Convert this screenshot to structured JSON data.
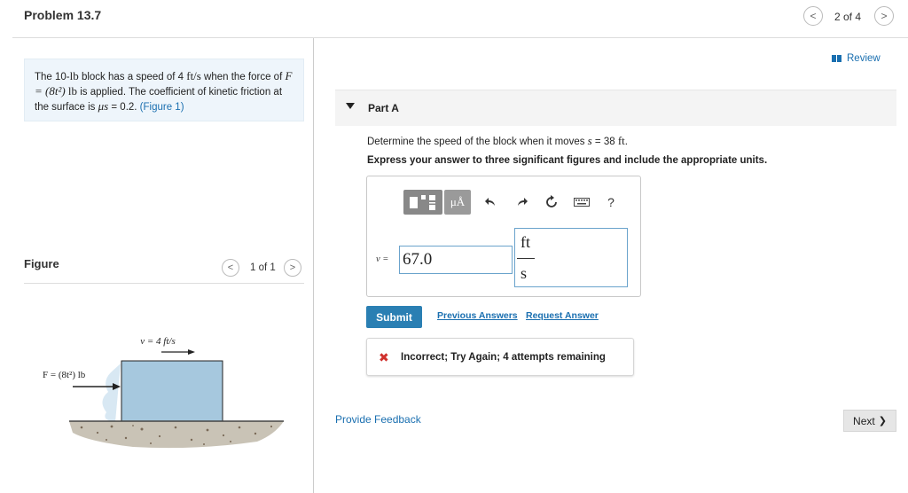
{
  "header": {
    "title": "Problem 13.7",
    "nav_prev_glyph": "<",
    "nav_count": "2 of 4",
    "nav_next_glyph": ">"
  },
  "problem": {
    "text_1": "The 10-",
    "mass_unit": "lb",
    "text_2": " block has a speed of 4 ",
    "speed_unit": "ft/s",
    "text_3": " when the force of",
    "force_expr": "F = (8t²)",
    "force_unit": "lb",
    "text_4": " is applied. The coefficient of kinetic friction at the surface is ",
    "mu_symbol": "μs",
    "text_5": " = 0.2. ",
    "figure_link": "(Figure 1)"
  },
  "figure": {
    "label": "Figure",
    "prev_glyph": "<",
    "count": "1 of 1",
    "next_glyph": ">",
    "velocity_label": "v = 4 ft/s",
    "force_label": "F = (8t²) lb",
    "block_color": "#a6c8de",
    "ground_color": "#c9c3b6"
  },
  "review": {
    "label": "Review"
  },
  "part_a": {
    "title": "Part A",
    "question_prefix": "Determine the speed of the block when it moves ",
    "question_var": "s",
    "question_value": " = 38 ",
    "question_unit": "ft",
    "question_suffix": ".",
    "instruction": "Express your answer to three significant figures and include the appropriate units."
  },
  "toolbar": {
    "units_label": "μÅ",
    "undo_icon": "undo-icon",
    "redo_icon": "redo-icon",
    "reset_icon": "reset-icon",
    "keyboard_icon": "keyboard-icon",
    "help_label": "?"
  },
  "answer": {
    "variable_label": "v =",
    "value": "67.0",
    "unit_numerator": "ft",
    "unit_denominator": "s"
  },
  "actions": {
    "submit_label": "Submit",
    "previous_answers_label": "Previous Answers",
    "request_answer_label": "Request Answer"
  },
  "feedback": {
    "icon": "x-icon",
    "icon_glyph": "✖",
    "message": "Incorrect; Try Again; 4 attempts remaining",
    "icon_color": "#d0312d"
  },
  "footer": {
    "provide_feedback_label": "Provide Feedback",
    "next_label": "Next",
    "next_glyph": "❯"
  },
  "colors": {
    "accent": "#1a6fb0",
    "submit_bg": "#2a7fb3",
    "problem_bg": "#eef5fb",
    "input_border": "#6aa3cc"
  }
}
